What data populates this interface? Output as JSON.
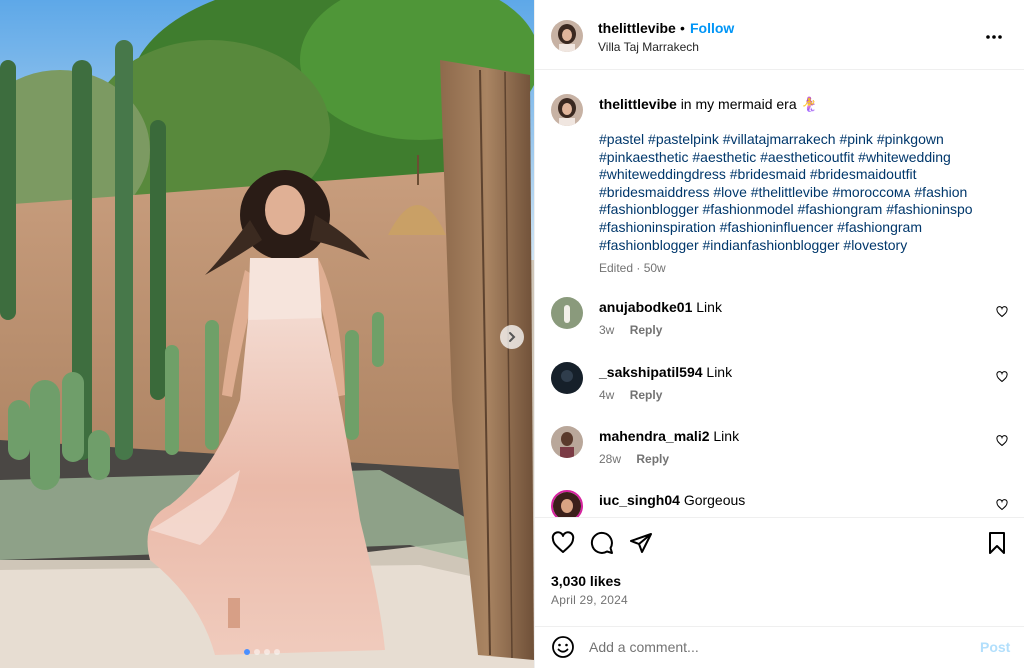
{
  "header": {
    "username": "thelittlevibe",
    "separator": "•",
    "follow_label": "Follow",
    "location": "Villa Taj Marrakech",
    "more_icon": "more-horizontal-icon"
  },
  "caption": {
    "username": "thelittlevibe",
    "text": "in my mermaid era 🧜‍♀️",
    "hashtags": "#pastel #pastelpink #villatajmarrakech #pink #pinkgown #pinkaesthetic #aesthetic #aestheticoutfit #whitewedding #whiteweddingdress #bridesmaid #bridesmaidoutfit #bridesmaiddress #love #thelittlevibe #moroccoᴍᴀ #fashion #fashionblogger #fashionmodel #fashiongram #fashioninspo #fashioninspiration #fashioninfluencer #fashiongram #fashionblogger #indianfashionblogger #lovestory",
    "edited": "Edited · 50w"
  },
  "comments": [
    {
      "username": "anujabodke01",
      "text": "Link",
      "age": "3w",
      "reply_label": "Reply"
    },
    {
      "username": "_sakshipatil594",
      "text": "Link",
      "age": "4w",
      "reply_label": "Reply"
    },
    {
      "username": "mahendra_mali2",
      "text": "Link",
      "age": "28w",
      "reply_label": "Reply"
    },
    {
      "username": "iuc_singh04",
      "text": "Gorgeous",
      "age": "",
      "reply_label": ""
    }
  ],
  "actions": {
    "likes": "3,030 likes",
    "date": "April 29, 2024",
    "icons": [
      "heart-icon",
      "comment-icon",
      "share-icon",
      "bookmark-icon"
    ]
  },
  "add_comment": {
    "placeholder": "Add a comment...",
    "post_label": "Post"
  },
  "media": {
    "slide_count": 4,
    "active_slide": 1
  },
  "colors": {
    "link_blue": "#0095f6",
    "hashtag_blue": "#00376b",
    "muted_gray": "#737373",
    "post_disabled": "#b2dffc"
  }
}
